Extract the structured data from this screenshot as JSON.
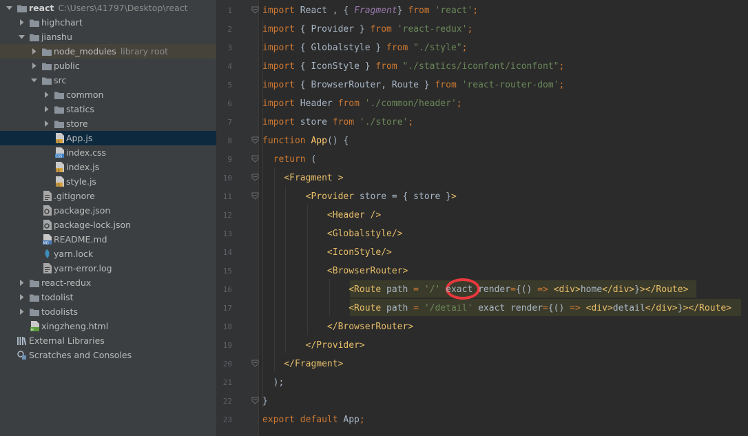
{
  "sidebar": {
    "items": [
      {
        "label": "react",
        "hint": "C:\\Users\\41797\\Desktop\\react",
        "bold": true,
        "depth": 0,
        "arrow": "down",
        "icon": "folder-icon",
        "type": "folder"
      },
      {
        "label": "highchart",
        "depth": 1,
        "arrow": "right",
        "icon": "folder-icon",
        "type": "folder"
      },
      {
        "label": "jianshu",
        "depth": 1,
        "arrow": "down",
        "icon": "folder-icon",
        "type": "folder"
      },
      {
        "label": "node_modules",
        "hint": "library root",
        "depth": 2,
        "arrow": "right",
        "icon": "folder-icon",
        "type": "folder",
        "lib": true
      },
      {
        "label": "public",
        "depth": 2,
        "arrow": "right",
        "icon": "folder-icon",
        "type": "folder"
      },
      {
        "label": "src",
        "depth": 2,
        "arrow": "down",
        "icon": "folder-icon",
        "type": "folder"
      },
      {
        "label": "common",
        "depth": 3,
        "arrow": "right",
        "icon": "folder-icon",
        "type": "folder"
      },
      {
        "label": "statics",
        "depth": 3,
        "arrow": "right",
        "icon": "folder-icon",
        "type": "folder"
      },
      {
        "label": "store",
        "depth": 3,
        "arrow": "right",
        "icon": "folder-icon",
        "type": "folder"
      },
      {
        "label": "App.js",
        "depth": 3,
        "arrow": "none",
        "icon": "js-file-icon",
        "type": "js",
        "selected": true
      },
      {
        "label": "index.css",
        "depth": 3,
        "arrow": "none",
        "icon": "css-file-icon",
        "type": "css"
      },
      {
        "label": "index.js",
        "depth": 3,
        "arrow": "none",
        "icon": "js-file-icon",
        "type": "js"
      },
      {
        "label": "style.js",
        "depth": 3,
        "arrow": "none",
        "icon": "js-file-icon",
        "type": "js"
      },
      {
        "label": ".gitignore",
        "depth": 2,
        "arrow": "none",
        "icon": "text-file-icon",
        "type": "txt"
      },
      {
        "label": "package.json",
        "depth": 2,
        "arrow": "none",
        "icon": "json-file-icon",
        "type": "json"
      },
      {
        "label": "package-lock.json",
        "depth": 2,
        "arrow": "none",
        "icon": "json-file-icon",
        "type": "json"
      },
      {
        "label": "README.md",
        "depth": 2,
        "arrow": "none",
        "icon": "markdown-file-icon",
        "type": "md"
      },
      {
        "label": "yarn.lock",
        "depth": 2,
        "arrow": "none",
        "icon": "yarn-file-icon",
        "type": "yarn"
      },
      {
        "label": "yarn-error.log",
        "depth": 2,
        "arrow": "none",
        "icon": "log-file-icon",
        "type": "txt"
      },
      {
        "label": "react-redux",
        "depth": 1,
        "arrow": "right",
        "icon": "folder-icon",
        "type": "folder"
      },
      {
        "label": "todolist",
        "depth": 1,
        "arrow": "right",
        "icon": "folder-icon",
        "type": "folder"
      },
      {
        "label": "todolists",
        "depth": 1,
        "arrow": "right",
        "icon": "folder-icon",
        "type": "folder"
      },
      {
        "label": "xingzheng.html",
        "depth": 1,
        "arrow": "none",
        "icon": "html-file-icon",
        "type": "html"
      },
      {
        "label": "External Libraries",
        "depth": 0,
        "arrow": "none",
        "icon": "libraries-icon",
        "type": "libs"
      },
      {
        "label": "Scratches and Consoles",
        "depth": 0,
        "arrow": "none",
        "icon": "scratches-icon",
        "type": "scratch"
      }
    ]
  },
  "editor": {
    "line_numbers": [
      "1",
      "2",
      "3",
      "4",
      "5",
      "6",
      "7",
      "8",
      "9",
      "10",
      "11",
      "12",
      "13",
      "14",
      "15",
      "16",
      "17",
      "18",
      "19",
      "20",
      "21",
      "22",
      "23"
    ],
    "lines": [
      [
        [
          "kw",
          "import "
        ],
        [
          "plain",
          "React , { "
        ],
        [
          "ital",
          "Fragment"
        ],
        [
          "plain",
          "} "
        ],
        [
          "kw",
          "from "
        ],
        [
          "str",
          "'react'"
        ],
        [
          "kw",
          ";"
        ]
      ],
      [
        [
          "kw",
          "import "
        ],
        [
          "plain",
          "{ Provider } "
        ],
        [
          "kw",
          "from "
        ],
        [
          "str",
          "'react-redux'"
        ],
        [
          "kw",
          ";"
        ]
      ],
      [
        [
          "kw",
          "import "
        ],
        [
          "plain",
          "{ Globalstyle } "
        ],
        [
          "kw",
          "from "
        ],
        [
          "str",
          "\"./style\""
        ],
        [
          "kw",
          ";"
        ]
      ],
      [
        [
          "kw",
          "import "
        ],
        [
          "plain",
          "{ IconStyle } "
        ],
        [
          "kw",
          "from "
        ],
        [
          "str",
          "\"./statics/iconfont/iconfont\""
        ],
        [
          "kw",
          ";"
        ]
      ],
      [
        [
          "kw",
          "import "
        ],
        [
          "plain",
          "{ BrowserRouter, Route } "
        ],
        [
          "kw",
          "from "
        ],
        [
          "str",
          "'react-router-dom'"
        ],
        [
          "kw",
          ";"
        ]
      ],
      [
        [
          "kw",
          "import "
        ],
        [
          "plain",
          "Header "
        ],
        [
          "kw",
          "from "
        ],
        [
          "str",
          "'./common/header'"
        ],
        [
          "kw",
          ";"
        ]
      ],
      [
        [
          "kw",
          "import "
        ],
        [
          "plain",
          "store "
        ],
        [
          "kw",
          "from "
        ],
        [
          "str",
          "'./store'"
        ],
        [
          "kw",
          ";"
        ]
      ],
      [
        [
          "kw",
          "function "
        ],
        [
          "fn",
          "App"
        ],
        [
          "plain",
          "() {"
        ]
      ],
      [
        [
          "plain",
          "  "
        ],
        [
          "kw",
          "return "
        ],
        [
          "plain",
          "("
        ]
      ],
      [
        [
          "plain",
          "    "
        ],
        [
          "tag",
          "<Fragment >"
        ]
      ],
      [
        [
          "plain",
          "        "
        ],
        [
          "tag",
          "<Provider "
        ],
        [
          "plain",
          "store = { store }"
        ],
        [
          "tag",
          ">"
        ]
      ],
      [
        [
          "plain",
          "            "
        ],
        [
          "tag",
          "<Header />"
        ]
      ],
      [
        [
          "plain",
          "            "
        ],
        [
          "tag",
          "<Globalstyle/>"
        ]
      ],
      [
        [
          "plain",
          "            "
        ],
        [
          "tag",
          "<IconStyle/>"
        ]
      ],
      [
        [
          "plain",
          "            "
        ],
        [
          "tag",
          "<BrowserRouter>"
        ]
      ],
      [
        [
          "plain",
          "                "
        ],
        [
          "tag",
          "<Route "
        ],
        [
          "plain",
          "path "
        ],
        [
          "kw",
          "= "
        ],
        [
          "str",
          "'/' "
        ],
        [
          "plain",
          "exact "
        ],
        [
          "plain",
          "render"
        ],
        [
          "kw",
          "="
        ],
        [
          "plain",
          "{() "
        ],
        [
          "kw",
          "=> "
        ],
        [
          "tag",
          "<div>"
        ],
        [
          "plain",
          "home"
        ],
        [
          "tag",
          "</div>"
        ],
        [
          "plain",
          "}"
        ],
        [
          "tag",
          "></Route>"
        ]
      ],
      [
        [
          "plain",
          "                "
        ],
        [
          "tag",
          "<Route "
        ],
        [
          "plain",
          "path "
        ],
        [
          "kw",
          "= "
        ],
        [
          "str",
          "'/detail' "
        ],
        [
          "plain",
          "exact render"
        ],
        [
          "kw",
          "="
        ],
        [
          "plain",
          "{() "
        ],
        [
          "kw",
          "=> "
        ],
        [
          "tag",
          "<div>"
        ],
        [
          "plain",
          "detail"
        ],
        [
          "tag",
          "</div>"
        ],
        [
          "plain",
          "}"
        ],
        [
          "tag",
          "></Route>"
        ]
      ],
      [
        [
          "plain",
          "            "
        ],
        [
          "tag",
          "</BrowserRouter>"
        ]
      ],
      [
        [
          "plain",
          "        "
        ],
        [
          "tag",
          "</Provider>"
        ]
      ],
      [
        [
          "plain",
          "    "
        ],
        [
          "tag",
          "</Fragment>"
        ]
      ],
      [
        [
          "plain",
          "  );"
        ]
      ],
      [
        [
          "plain",
          "}"
        ]
      ],
      [
        [
          "kw",
          "export default "
        ],
        [
          "plain",
          "App"
        ],
        [
          "kw",
          ";"
        ]
      ]
    ]
  }
}
